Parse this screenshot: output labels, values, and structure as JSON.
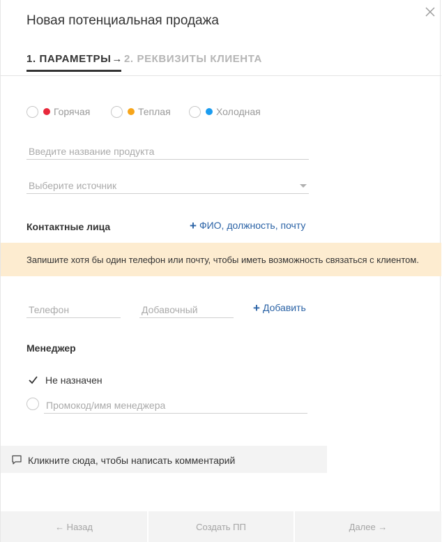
{
  "dialog": {
    "title": "Новая потенциальная продажа",
    "close_icon": "close-icon"
  },
  "steps": {
    "step1": "1. ПАРАМЕТРЫ",
    "arrow": "→",
    "step2": "2. РЕКВИЗИТЫ КЛИЕНТА"
  },
  "temperature": {
    "options": [
      {
        "label": "Горячая",
        "color": "#e8293b"
      },
      {
        "label": "Теплая",
        "color": "#f7a51a"
      },
      {
        "label": "Холодная",
        "color": "#1a9cf0"
      }
    ]
  },
  "product": {
    "placeholder": "Введите название продукта"
  },
  "source": {
    "placeholder": "Выберите источник"
  },
  "contacts": {
    "label": "Контактные лица",
    "add_link": "ФИО, должность, почту",
    "plus": "+"
  },
  "notice": {
    "text": "Запишите хотя бы один телефон или почту, чтобы иметь возможность связаться с клиентом."
  },
  "phone": {
    "placeholder": "Телефон",
    "ext_placeholder": "Добавочный",
    "add_label": "Добавить",
    "plus": "+"
  },
  "manager": {
    "label": "Менеджер",
    "none_label": "Не назначен",
    "promo_placeholder": "Промокод/имя менеджера"
  },
  "comment": {
    "text": "Кликните сюда, чтобы написать комментарий",
    "icon": "comment-icon"
  },
  "footer": {
    "back": "← Назад",
    "create": "Создать ПП",
    "next": "Далее →"
  },
  "colors": {
    "accent": "#2b63a6",
    "notice_bg": "#fdecd0",
    "footer_bg": "#f3f3f3"
  }
}
